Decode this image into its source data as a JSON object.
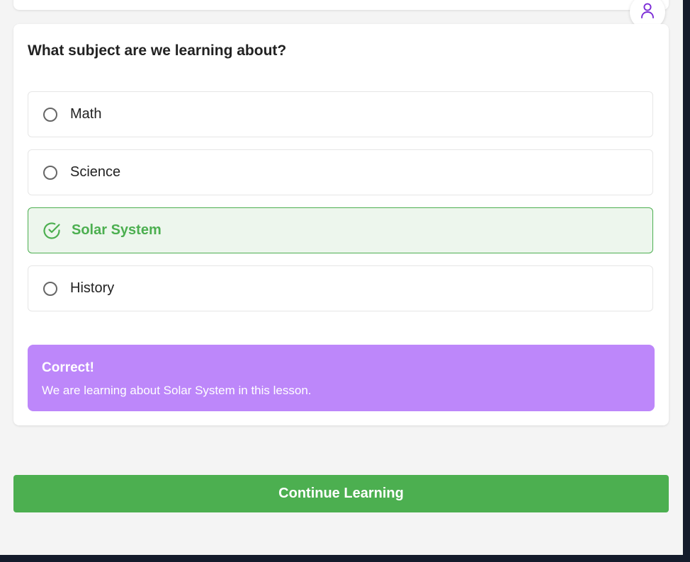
{
  "quiz": {
    "question": "What subject are we learning about?",
    "options": [
      {
        "label": "Math",
        "selected": false
      },
      {
        "label": "Science",
        "selected": false
      },
      {
        "label": "Solar System",
        "selected": true
      },
      {
        "label": "History",
        "selected": false
      }
    ],
    "feedback": {
      "title": "Correct!",
      "message": "We are learning about Solar System in this lesson."
    }
  },
  "actions": {
    "continue_label": "Continue Learning"
  },
  "icons": {
    "profile": "user-icon",
    "selected_option": "check-circle-icon",
    "unselected_option": "radio-circle-icon"
  },
  "colors": {
    "success": "#4caf50",
    "success_bg": "#edf6ed",
    "feedback_bg": "#bd87fa",
    "profile_accent": "#7b2bd6",
    "page_bg": "#f4f4f4",
    "frame_bg": "#141b2b"
  }
}
